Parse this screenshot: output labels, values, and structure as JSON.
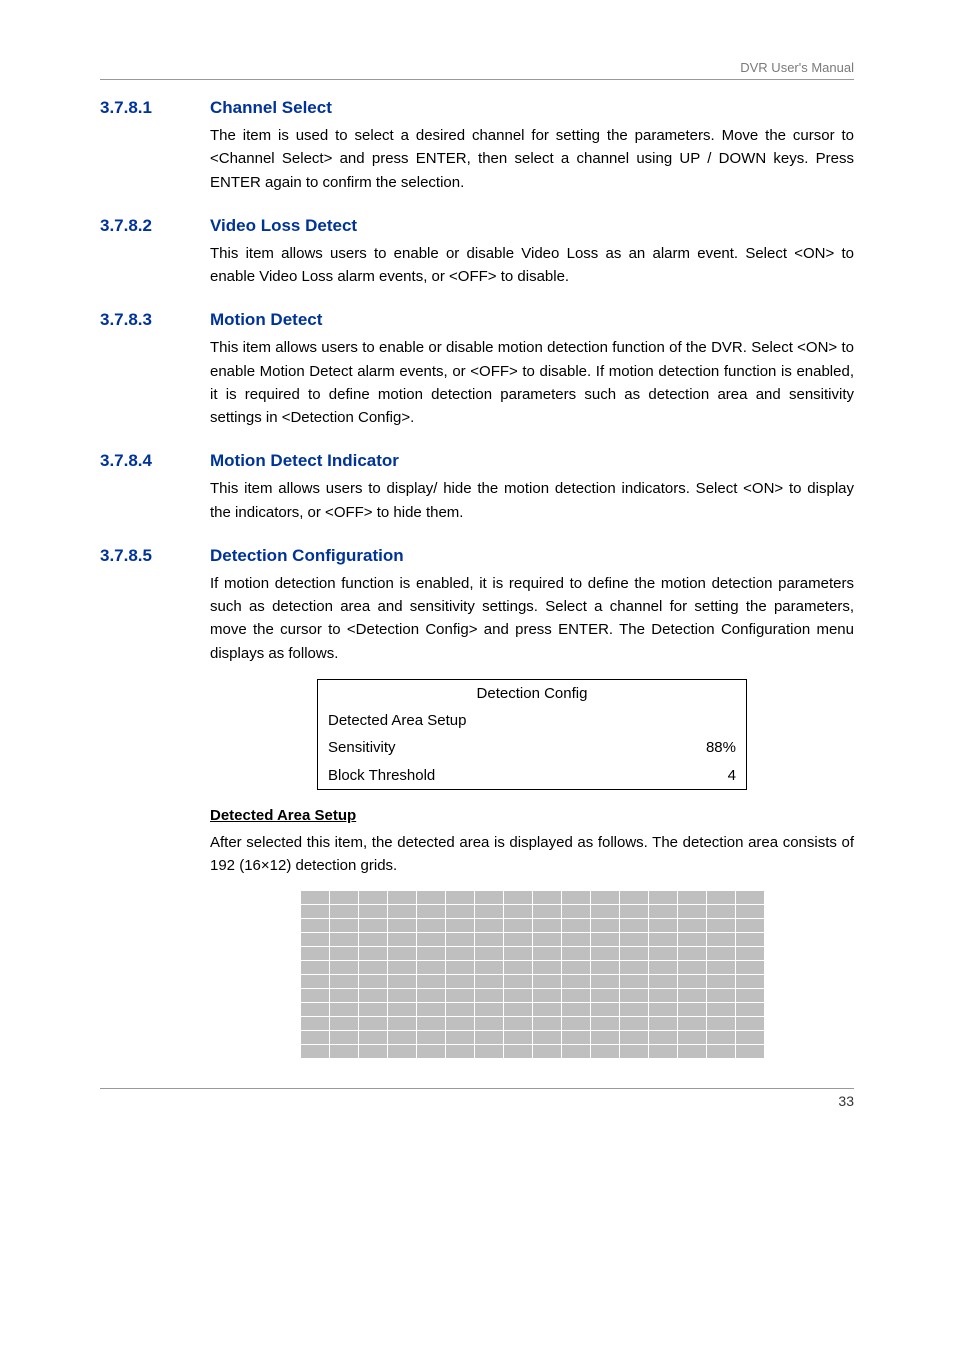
{
  "header": {
    "right_text": "DVR User's Manual"
  },
  "sections": {
    "s1": {
      "num": "3.7.8.1",
      "title": "Channel Select",
      "body": "The item is used to select a desired channel for setting the parameters. Move the cursor to <Channel Select> and press ENTER, then select a channel using UP / DOWN keys. Press ENTER again to confirm the selection."
    },
    "s2": {
      "num": "3.7.8.2",
      "title": "Video Loss Detect",
      "body": "This item allows users to enable or disable Video Loss as an alarm event. Select <ON> to enable Video Loss alarm events, or <OFF> to disable."
    },
    "s3": {
      "num": "3.7.8.3",
      "title": "Motion Detect",
      "body": "This item allows users to enable or disable motion detection function of the DVR. Select <ON> to enable Motion Detect alarm events, or <OFF> to disable. If motion detection function is enabled, it is required to define motion detection parameters such as detection area and sensitivity settings in <Detection Config>."
    },
    "s4": {
      "num": "3.7.8.4",
      "title": "Motion Detect Indicator",
      "body": "This item allows users to display/ hide the motion detection indicators. Select <ON> to display the indicators, or <OFF> to hide them."
    },
    "s5": {
      "num": "3.7.8.5",
      "title": "Detection Configuration",
      "body": "If motion detection function is enabled, it is required to define the motion detection parameters such as detection area and sensitivity settings. Select a channel for setting the parameters, move the cursor to <Detection Config> and press ENTER. The Detection Configuration menu displays as follows.",
      "table": {
        "title": "Detection Config",
        "row1_label": "Detected Area Setup",
        "row2_label": "Sensitivity",
        "row2_val": "88%",
        "row3_label": "Block Threshold",
        "row3_val": "4"
      },
      "subhead": "Detected Area Setup",
      "sub_body": "After selected this item, the detected area is displayed as follows. The detection area consists of 192 (16×12) detection grids."
    }
  },
  "grid": {
    "cols": 16,
    "rows": 12
  },
  "footer": {
    "page_num": "33"
  }
}
